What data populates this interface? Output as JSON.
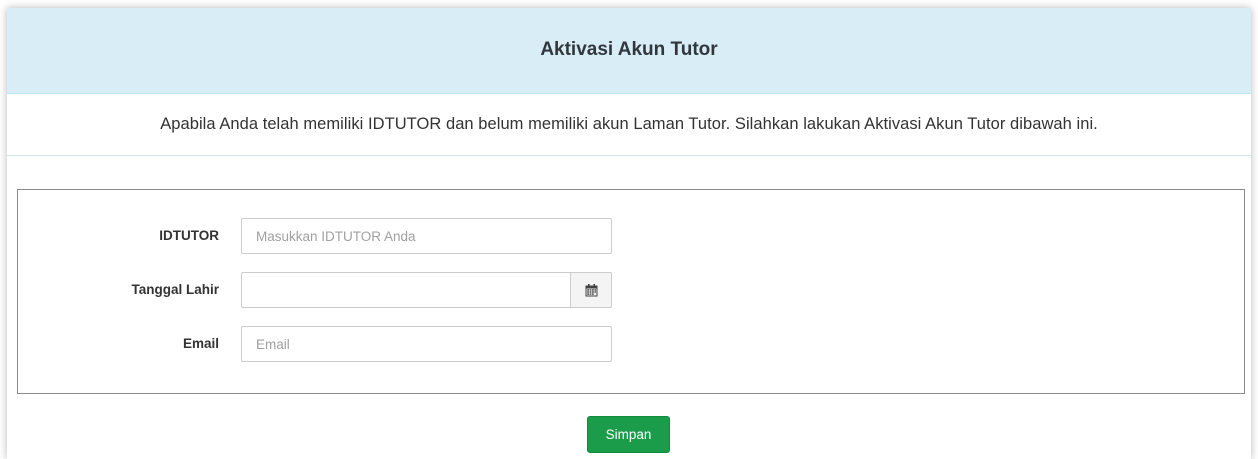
{
  "header": {
    "title": "Aktivasi Akun Tutor"
  },
  "notice": {
    "text": "Apabila Anda telah memiliki IDTUTOR dan belum memiliki akun Laman Tutor. Silahkan lakukan Aktivasi Akun Tutor dibawah ini."
  },
  "form": {
    "idtutor": {
      "label": "IDTUTOR",
      "value": "",
      "placeholder": "Masukkan IDTUTOR Anda"
    },
    "birth_date": {
      "label": "Tanggal Lahir",
      "value": "",
      "addon_icon": "calendar-icon"
    },
    "email": {
      "label": "Email",
      "value": "",
      "placeholder": "Email"
    },
    "submit_label": "Simpan"
  },
  "colors": {
    "header_bg": "#d9edf7",
    "button_bg": "#1a9c4a"
  }
}
